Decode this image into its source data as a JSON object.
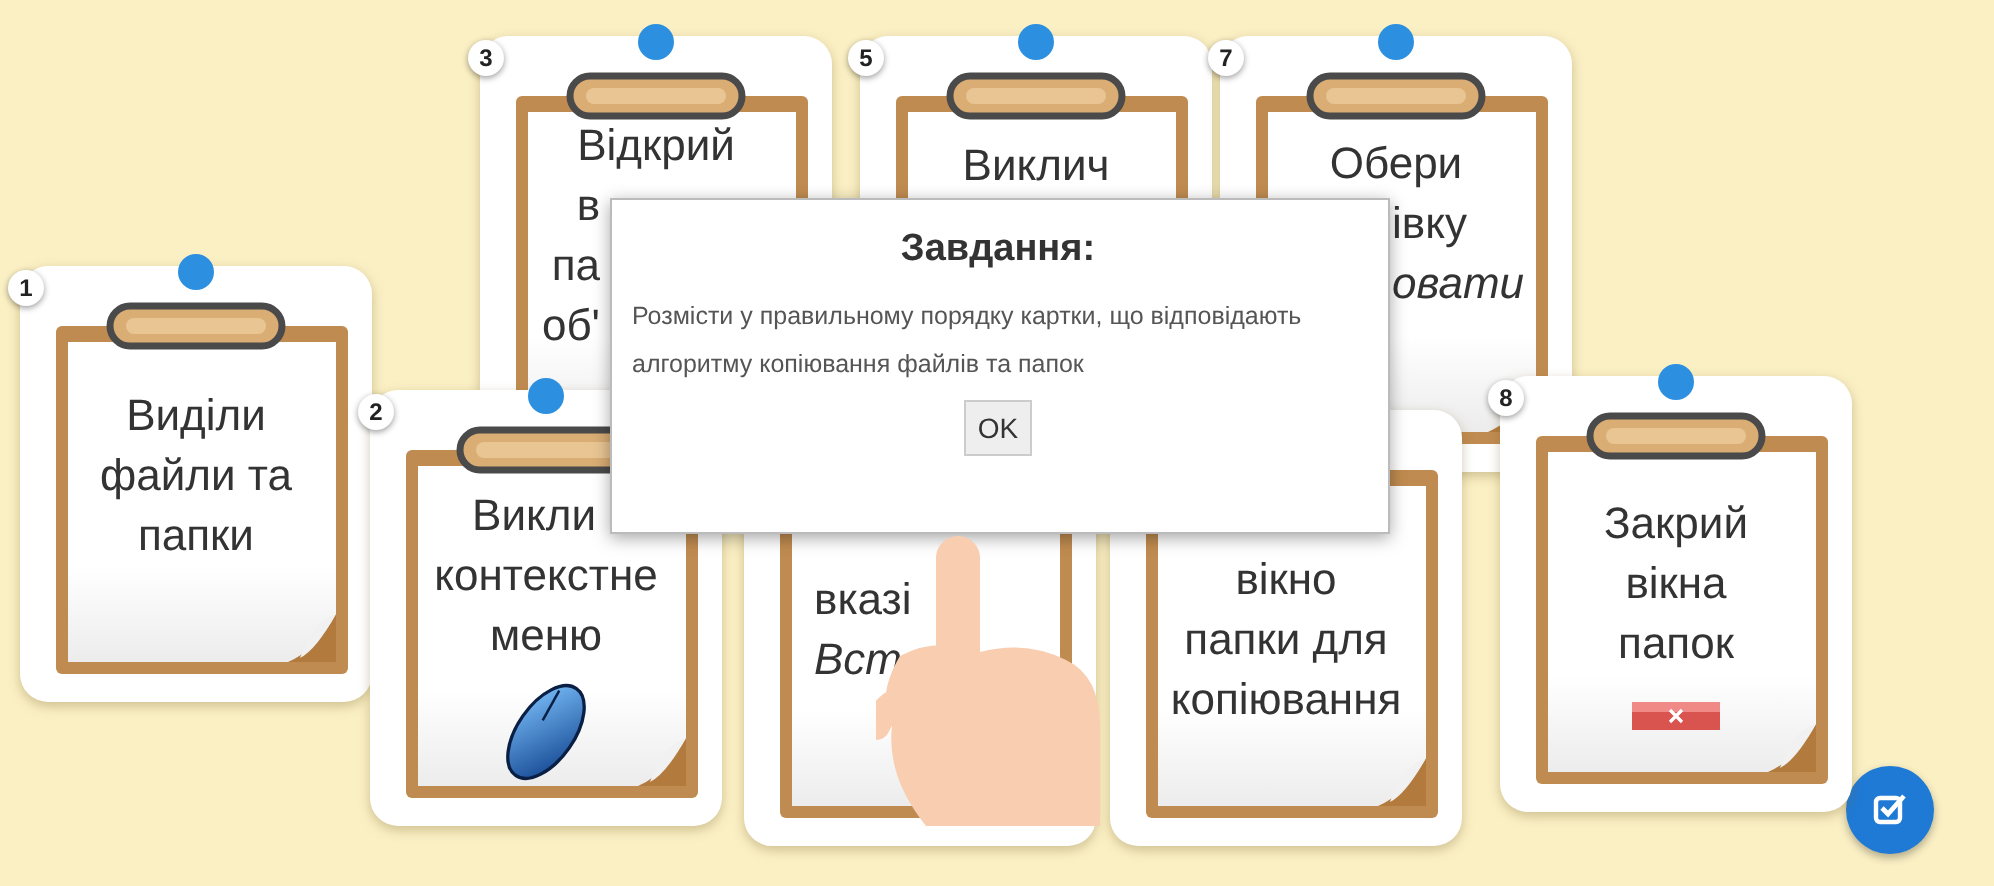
{
  "cards": [
    {
      "number": "3",
      "lines": [
        "Відкрий",
        "в",
        "па",
        "об'"
      ]
    },
    {
      "number": "5",
      "lines": [
        "Виклич"
      ]
    },
    {
      "number": "7",
      "lines": [
        "Обери",
        "івку",
        "*овати*"
      ]
    },
    {
      "number": "1",
      "lines": [
        "Виділи",
        "файли та",
        "папки"
      ]
    },
    {
      "number": "2",
      "lines": [
        "Викли",
        "контекстне",
        "меню"
      ]
    },
    {
      "lines": [
        "вказі",
        "*Вст*"
      ]
    },
    {
      "lines": [
        "вікно",
        "папки для",
        "копіювання"
      ]
    },
    {
      "number": "8",
      "lines": [
        "Закрий",
        "вікна",
        "папок"
      ]
    }
  ],
  "dialog": {
    "title": "Завдання:",
    "text": "Розмісти у правильному порядку картки, що відповідають алгоритму копіювання файлів та папок",
    "button": "OK"
  }
}
